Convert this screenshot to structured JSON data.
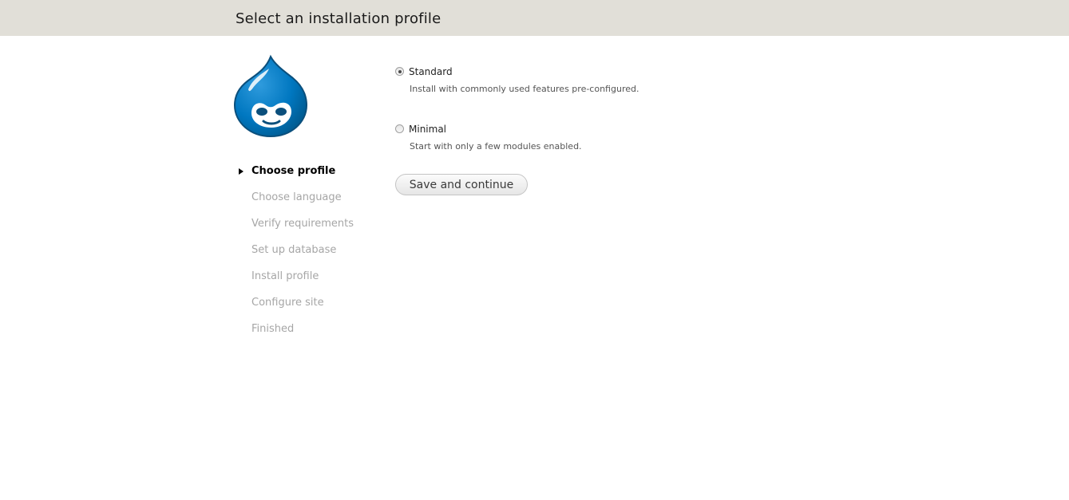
{
  "header": {
    "title": "Select an installation profile"
  },
  "logo": {
    "icon": "drupal-drop-logo",
    "colors": {
      "primary": "#0077c0",
      "dark": "#00598e",
      "face": "#ffffff"
    }
  },
  "steps": [
    {
      "label": "Choose profile",
      "active": true
    },
    {
      "label": "Choose language",
      "active": false
    },
    {
      "label": "Verify requirements",
      "active": false
    },
    {
      "label": "Set up database",
      "active": false
    },
    {
      "label": "Install profile",
      "active": false
    },
    {
      "label": "Configure site",
      "active": false
    },
    {
      "label": "Finished",
      "active": false
    }
  ],
  "profiles": {
    "selected": "Standard",
    "options": [
      {
        "label": "Standard",
        "description": "Install with commonly used features pre-configured.",
        "checked": true
      },
      {
        "label": "Minimal",
        "description": "Start with only a few modules enabled.",
        "checked": false
      }
    ]
  },
  "actions": {
    "save_label": "Save and continue"
  }
}
